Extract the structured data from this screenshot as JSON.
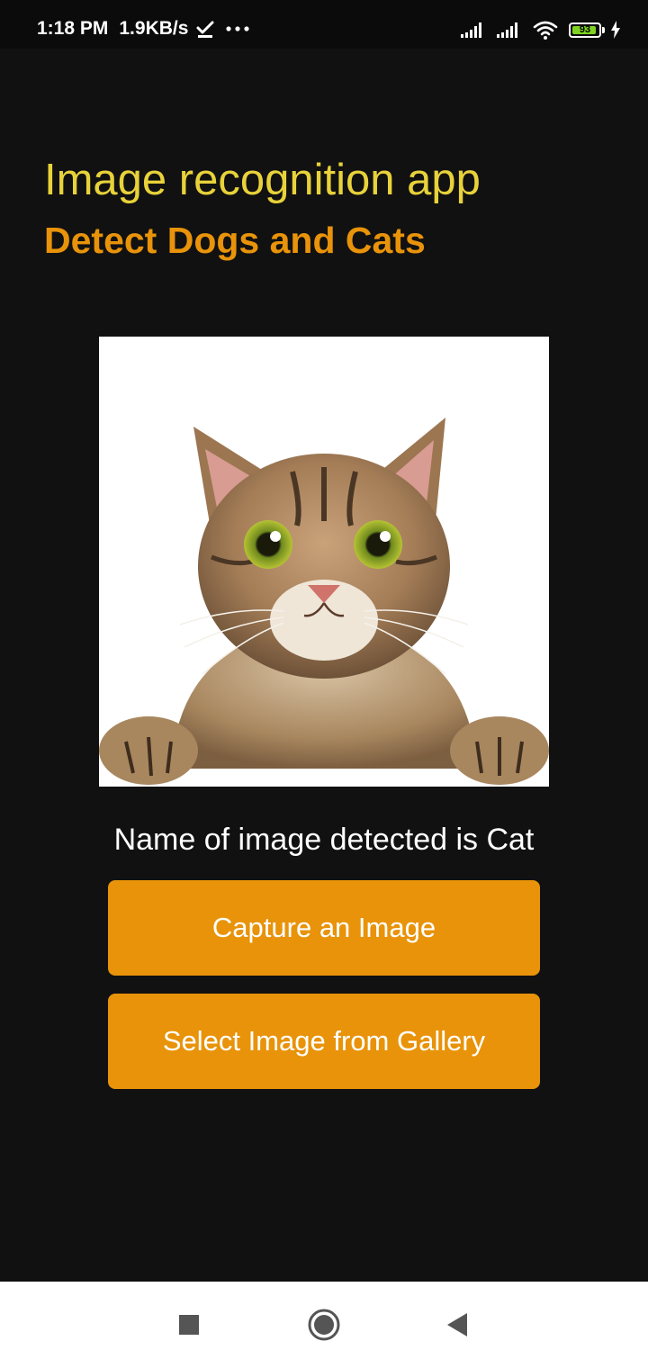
{
  "status_bar": {
    "time": "1:18 PM",
    "speed": "1.9KB/s",
    "battery_level": "93",
    "battery_fraction": 0.93,
    "icons": [
      "download-done-icon",
      "more-dots-icon",
      "signal-icon",
      "signal-icon",
      "wifi-icon",
      "battery-icon",
      "charging-icon"
    ]
  },
  "header": {
    "title": "Image recognition app",
    "subtitle": "Detect Dogs and Cats"
  },
  "result": {
    "text": "Name of image detected is Cat"
  },
  "buttons": {
    "capture_label": "Capture an Image",
    "gallery_label": "Select Image from Gallery"
  },
  "nav_bar": {
    "icons": [
      "recents-square-icon",
      "home-circle-icon",
      "back-triangle-icon"
    ]
  },
  "colors": {
    "background": "#111111",
    "title": "#e8d23a",
    "subtitle": "#e8930a",
    "button": "#e8930a",
    "battery": "#7ed321"
  }
}
